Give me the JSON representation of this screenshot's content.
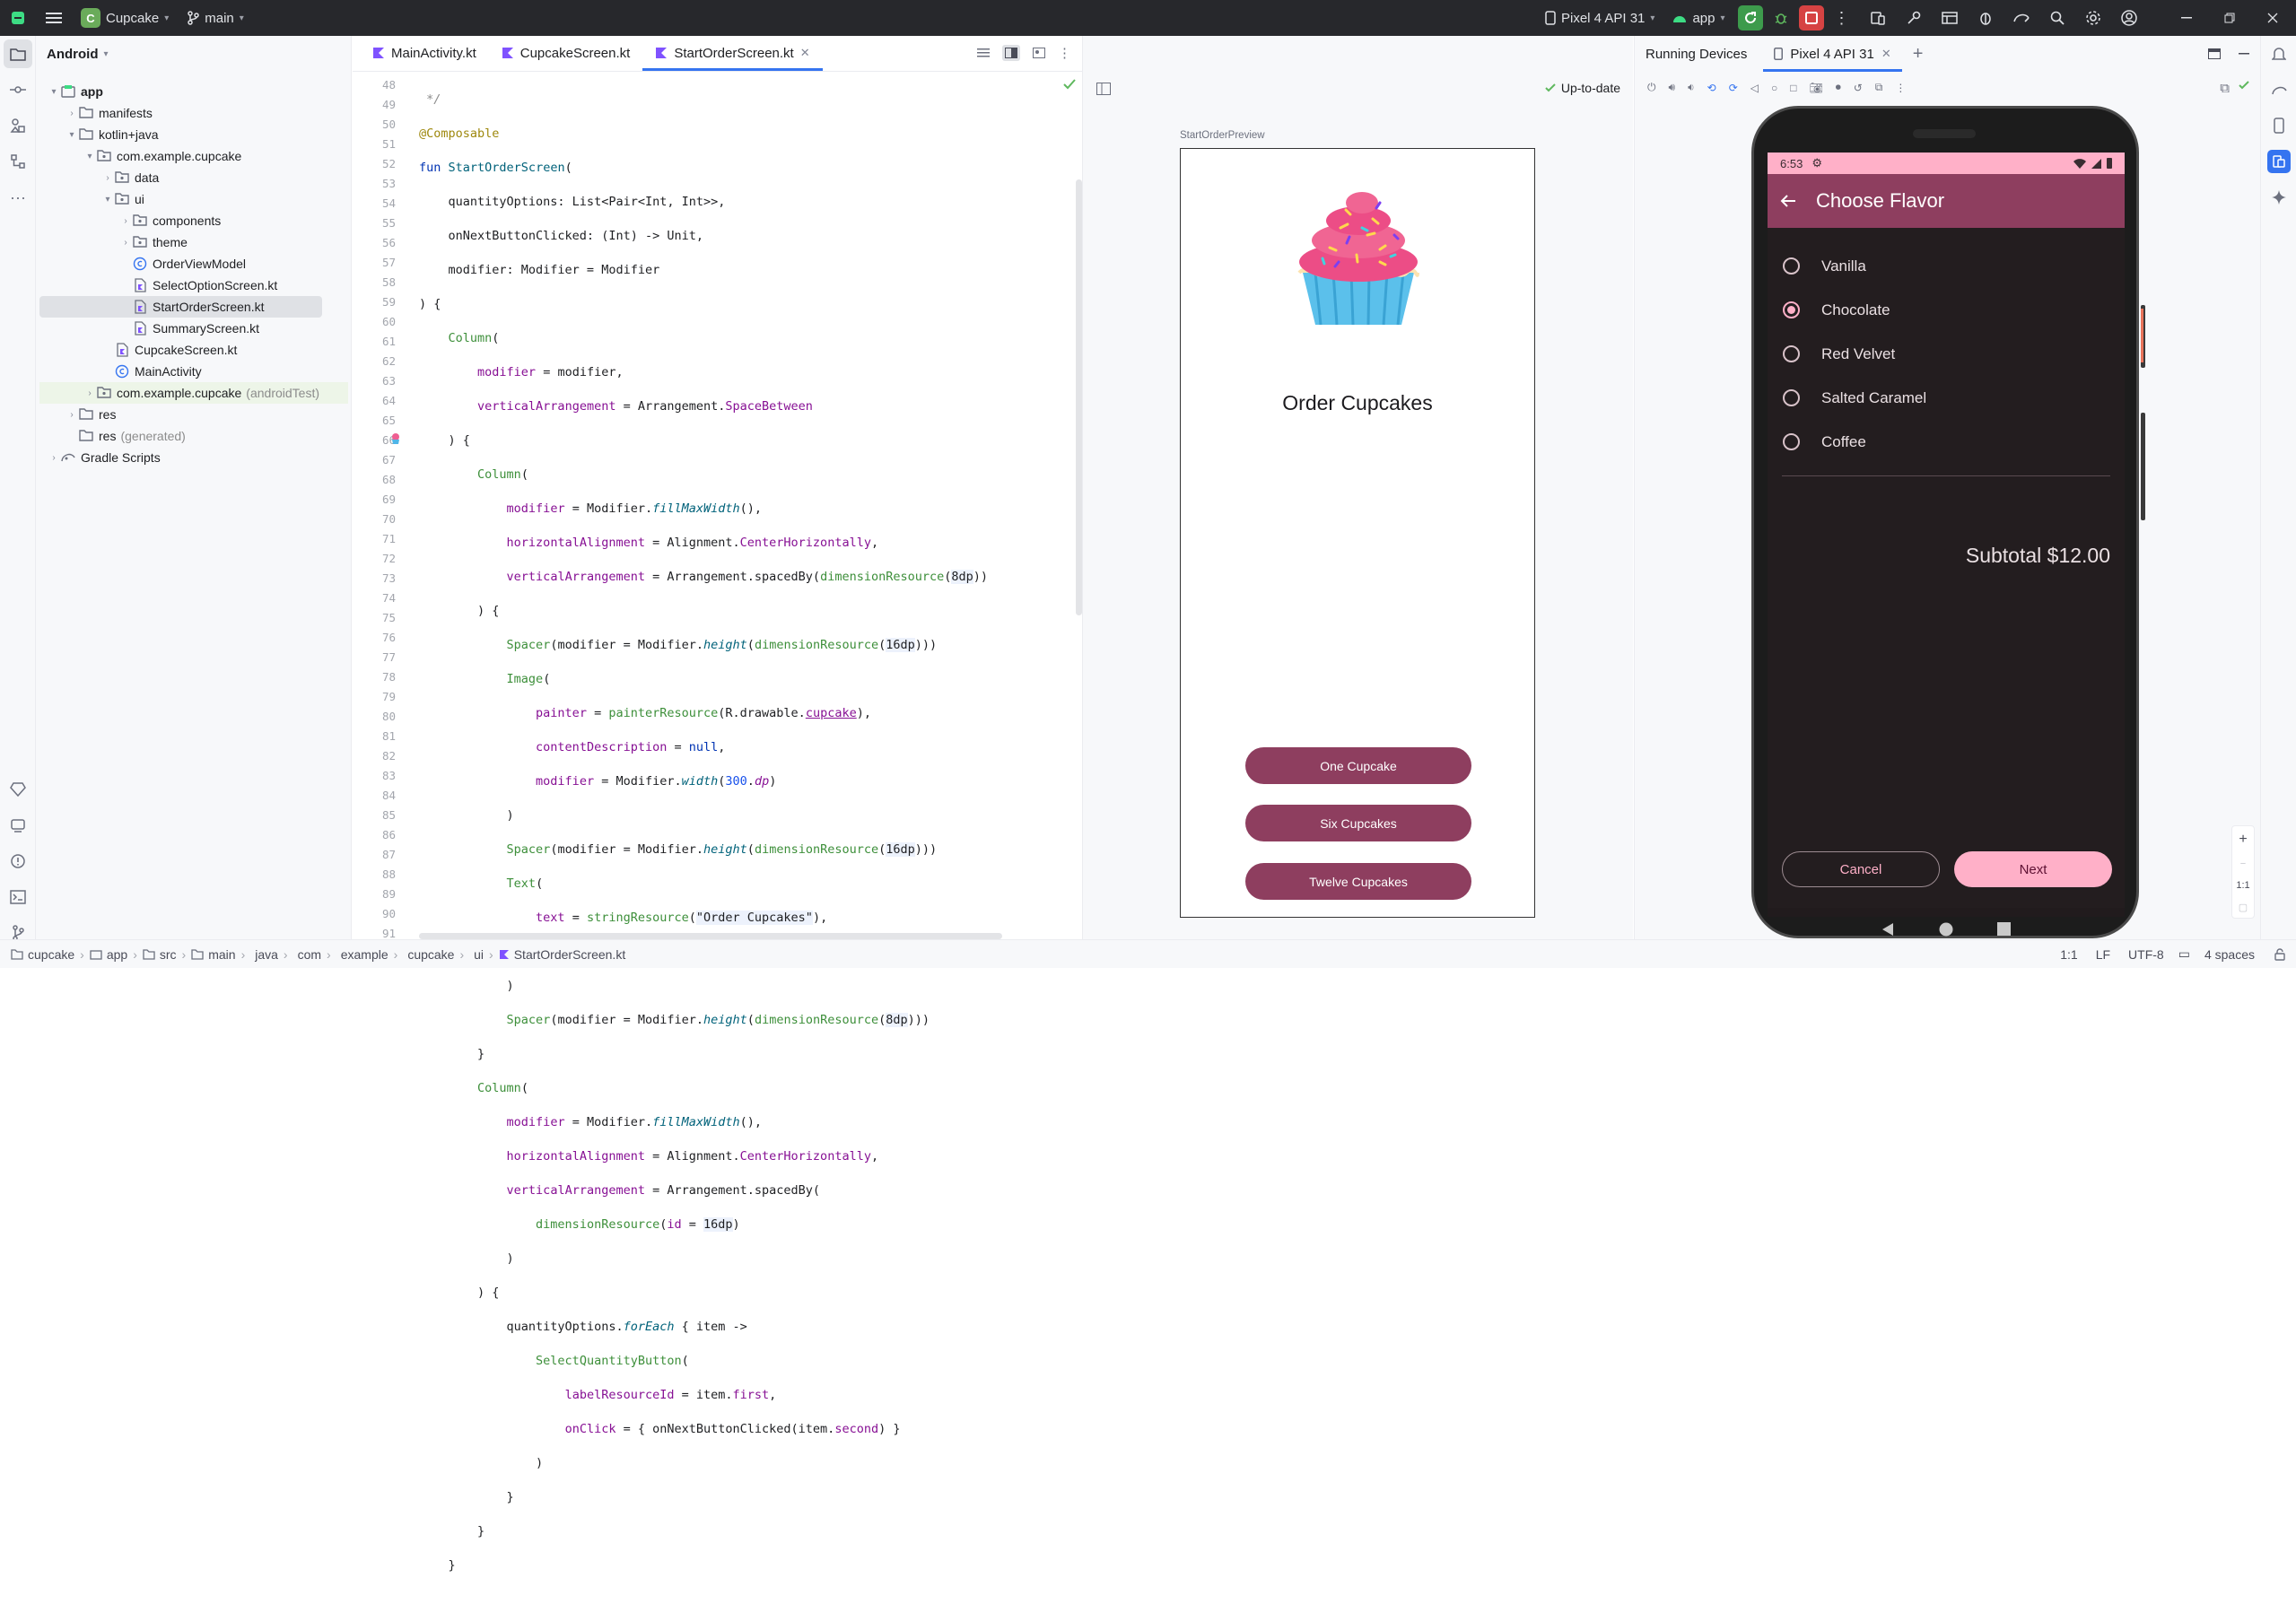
{
  "titlebar": {
    "project_badge": "C",
    "project_name": "Cupcake",
    "branch": "main",
    "device": "Pixel 4 API 31",
    "run_config": "app"
  },
  "project_panel": {
    "view_mode": "Android",
    "tree": [
      {
        "label": "app",
        "suffix": "",
        "icon": "module-icon"
      },
      {
        "label": "manifests",
        "suffix": "",
        "icon": "folder-icon"
      },
      {
        "label": "kotlin+java",
        "suffix": "",
        "icon": "folder-icon"
      },
      {
        "label": "com.example.cupcake",
        "suffix": "",
        "icon": "package-icon"
      },
      {
        "label": "data",
        "suffix": "",
        "icon": "package-icon"
      },
      {
        "label": "ui",
        "suffix": "",
        "icon": "package-icon"
      },
      {
        "label": "components",
        "suffix": "",
        "icon": "package-icon"
      },
      {
        "label": "theme",
        "suffix": "",
        "icon": "package-icon"
      },
      {
        "label": "OrderViewModel",
        "suffix": "",
        "icon": "class-icon"
      },
      {
        "label": "SelectOptionScreen.kt",
        "suffix": "",
        "icon": "kotlin-file-icon"
      },
      {
        "label": "StartOrderScreen.kt",
        "suffix": "",
        "icon": "kotlin-file-icon"
      },
      {
        "label": "SummaryScreen.kt",
        "suffix": "",
        "icon": "kotlin-file-icon"
      },
      {
        "label": "CupcakeScreen.kt",
        "suffix": "",
        "icon": "kotlin-file-icon"
      },
      {
        "label": "MainActivity",
        "suffix": "",
        "icon": "class-icon"
      },
      {
        "label": "com.example.cupcake",
        "suffix": "(androidTest)",
        "icon": "package-icon"
      },
      {
        "label": "res",
        "suffix": "",
        "icon": "folder-icon"
      },
      {
        "label": "res",
        "suffix": "(generated)",
        "icon": "folder-icon"
      },
      {
        "label": "Gradle Scripts",
        "suffix": "",
        "icon": "gradle-icon"
      }
    ]
  },
  "editor": {
    "tabs": [
      {
        "label": "MainActivity.kt"
      },
      {
        "label": "CupcakeScreen.kt"
      },
      {
        "label": "StartOrderScreen.kt"
      }
    ],
    "line_numbers": [
      "48",
      "49",
      "50",
      "51",
      "52",
      "53",
      "54",
      "55",
      "56",
      "57",
      "58",
      "59",
      "60",
      "61",
      "62",
      "63",
      "64",
      "65",
      "66",
      "67",
      "68",
      "69",
      "70",
      "71",
      "72",
      "73",
      "74",
      "75",
      "76",
      "77",
      "78",
      "79",
      "80",
      "81",
      "82",
      "83",
      "84",
      "85",
      "86",
      "87",
      "88",
      "89",
      "90",
      "91"
    ]
  },
  "preview": {
    "status": "Up-to-date",
    "preview_name": "StartOrderPreview",
    "title": "Order Cupcakes",
    "buttons": [
      "One Cupcake",
      "Six Cupcakes",
      "Twelve Cupcakes"
    ]
  },
  "running_devices": {
    "panel_title": "Running Devices",
    "device_tab": "Pixel 4 API 31",
    "zoom_label": "1:1",
    "phone": {
      "time": "6:53",
      "app_title": "Choose Flavor",
      "flavors": [
        "Vanilla",
        "Chocolate",
        "Red Velvet",
        "Salted Caramel",
        "Coffee"
      ],
      "selected": "Chocolate",
      "subtotal": "Subtotal $12.00",
      "cancel": "Cancel",
      "next": "Next"
    }
  },
  "statusbar": {
    "breadcrumbs": [
      "cupcake",
      "app",
      "src",
      "main",
      "java",
      "com",
      "example",
      "cupcake",
      "ui",
      "StartOrderScreen.kt"
    ],
    "position": "1:1",
    "line_ending": "LF",
    "encoding": "UTF-8",
    "indent": "4 spaces"
  }
}
